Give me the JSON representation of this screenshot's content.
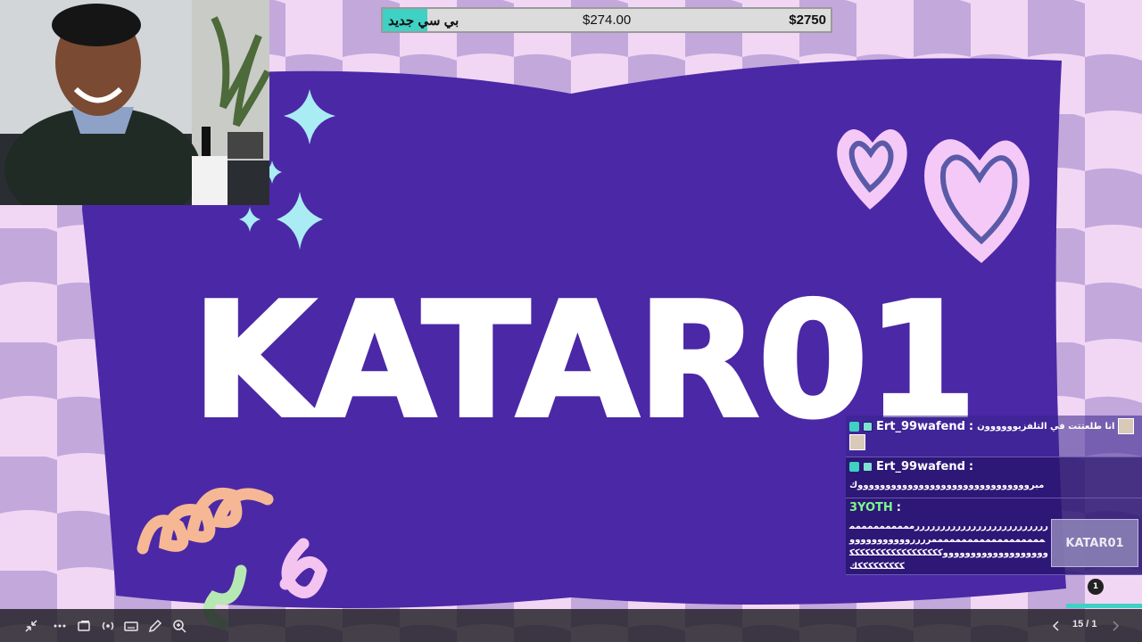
{
  "goal": {
    "label": "بي سي جديد",
    "current": "$274.00",
    "target": "$2750",
    "progress": 0.0996,
    "fill_color": "#3fd1c4"
  },
  "banner": {
    "title": "KATAR01",
    "panel_color": "#4b28a6",
    "sparkle_color": "#a9ecf3",
    "heart_color": "#f5c9f7"
  },
  "chat": {
    "messages": [
      {
        "user": "Ert_99wafend",
        "separator": ":",
        "text": "انا طلعتتت في التلفزيوووووون"
      },
      {
        "user": "Ert_99wafend",
        "separator": ":",
        "text": "مبروووووووووووووووووووووووووووووووك"
      },
      {
        "user": "3YOTH",
        "separator": ":",
        "text": "ررررررررررررررررررررررررررممممممممممممممممممممممممممممممررررووووووووووووووووووووووووووووووكككككككككككككككككككككككككككك"
      }
    ],
    "preview_label": "KATAR01",
    "unread_count": "1"
  },
  "toolbar": {
    "icons": [
      "exit-fullscreen-icon",
      "more-icon",
      "screen-icon",
      "broadcast-icon",
      "keyboard-icon",
      "pen-icon",
      "zoom-icon"
    ],
    "page": "15 / 1"
  }
}
